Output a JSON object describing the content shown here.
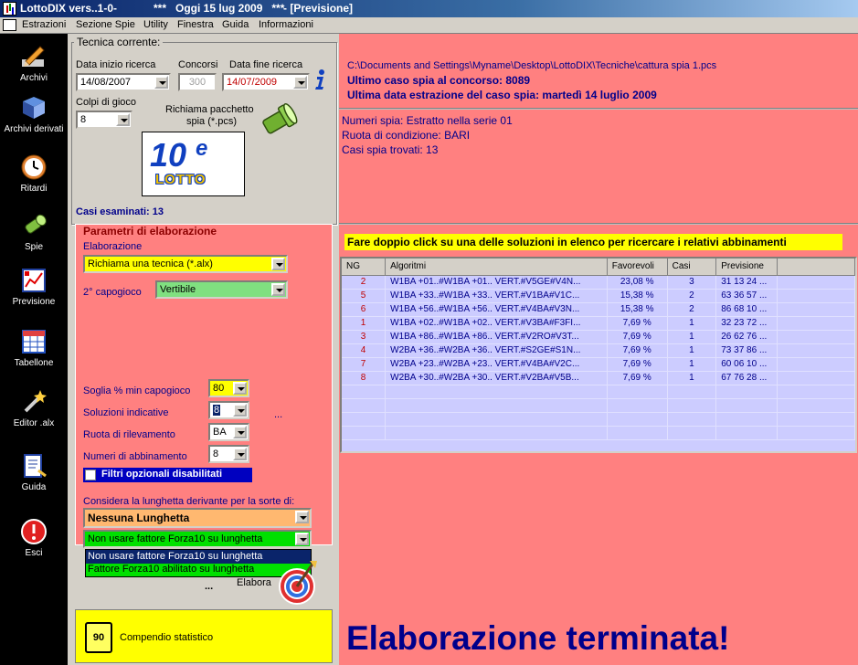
{
  "titlebar": {
    "app_name": "LottoDIX vers..1-0-",
    "date_text": "***   Oggi 15 lug 2009   ***",
    "window_name": "- [Previsione]"
  },
  "menu": [
    "Estrazioni",
    "Sezione Spie",
    "Utility",
    "Finestra",
    "Guida",
    "Informazioni"
  ],
  "sidebar": [
    {
      "label": "Archivi",
      "icon": "pencil-icon"
    },
    {
      "label": "Archivi derivati",
      "icon": "book-icon"
    },
    {
      "label": "Ritardi",
      "icon": "clock-icon"
    },
    {
      "label": "Spie",
      "icon": "flashlight-icon"
    },
    {
      "label": "Previsione",
      "icon": "chart-icon"
    },
    {
      "label": "Tabellone",
      "icon": "grid-icon"
    },
    {
      "label": "Editor .alx",
      "icon": "wand-icon"
    },
    {
      "label": "Guida",
      "icon": "help-book-icon"
    },
    {
      "label": "Esci",
      "icon": "exit-icon"
    }
  ],
  "technique": {
    "legend": "Tecnica corrente:",
    "start_label": "Data inizio ricerca",
    "start_value": "14/08/2007",
    "concorsi_label": "Concorsi",
    "concorsi_value": "300",
    "end_label": "Data fine ricerca",
    "end_value": "14/07/2009",
    "colpi_label": "Colpi di gioco",
    "colpi_value": "8",
    "richiama_label_1": "Richiama pacchetto",
    "richiama_label_2": "spia (*.pcs)",
    "logo_big": "10",
    "logo_e": "e",
    "logo_word": "LOTTO",
    "casi_label": "Casi esaminati: 13"
  },
  "params": {
    "legend": "Parametri di elaborazione",
    "elaborazione_label": "Elaborazione",
    "elaborazione_value": "Richiama una tecnica (*.alx)",
    "capogioco_label": "2° capogioco",
    "capogioco_value": "Vertibile",
    "soglia_label": "Soglia % min capogioco",
    "soglia_value": "80",
    "soluzioni_label": "Soluzioni indicative",
    "soluzioni_value": "8",
    "ellipsis": "...",
    "ruota_label": "Ruota di rilevamento",
    "ruota_value": "BA",
    "numeri_label": "Numeri di abbinamento",
    "numeri_value": "8",
    "filtri_label": "Filtri opzionali disabilitati",
    "lunghetta_label": "Considera la lunghetta derivante per la sorte di:",
    "lunghetta_value": "Nessuna Lunghetta",
    "forza_value": "Non usare fattore Forza10 su lunghetta",
    "dropdown_options": [
      "Non usare fattore Forza10 su lunghetta",
      "Fattore Forza10 abilitato su lunghetta"
    ],
    "elabora_label": "Elabora",
    "elabora_ellipsis": "..."
  },
  "compendio": {
    "badge": "90",
    "label": "Compendio statistico"
  },
  "info": {
    "path": "C:\\Documents and Settings\\Myname\\Desktop\\LottoDIX\\Tecniche\\cattura spia 1.pcs",
    "ultimo": "Ultimo caso spia al concorso:  8089",
    "ultima_data": "Ultima data estrazione del caso spia:  martedì 14 luglio 2009",
    "numeri_spia": "Numeri spia: Estratto nella serie 01",
    "ruota": "Ruota di condizione: BARI",
    "casi_trovati": "Casi spia trovati: 13"
  },
  "banner": "Fare doppio click su una delle soluzioni in elenco per ricercare i relativi abbinamenti",
  "grid": {
    "headers": [
      "NG",
      "Algoritmi",
      "Favorevoli",
      "Casi",
      "Previsione"
    ],
    "rows": [
      [
        "2",
        "W1BA +01..#W1BA +01.. VERT.#V5GE#V4N...",
        "23,08 %",
        "3",
        "31 13 24 ..."
      ],
      [
        "5",
        "W1BA +33..#W1BA +33.. VERT.#V1BA#V1C...",
        "15,38 %",
        "2",
        "63 36 57 ..."
      ],
      [
        "6",
        "W1BA +56..#W1BA +56.. VERT.#V4BA#V3N...",
        "15,38 %",
        "2",
        "86 68 10 ..."
      ],
      [
        "1",
        "W1BA +02..#W1BA +02.. VERT.#V3BA#F3FI...",
        "7,69 %",
        "1",
        "32 23 72 ..."
      ],
      [
        "3",
        "W1BA +86..#W1BA +86.. VERT.#V2RO#V3T...",
        "7,69 %",
        "1",
        "26 62 76 ..."
      ],
      [
        "4",
        "W2BA +36..#W2BA +36.. VERT.#S2GE#S1N...",
        "7,69 %",
        "1",
        "73 37 86 ..."
      ],
      [
        "7",
        "W2BA +23..#W2BA +23.. VERT.#V4BA#V2C...",
        "7,69 %",
        "1",
        "60 06 10 ..."
      ],
      [
        "8",
        "W2BA +30..#W2BA +30.. VERT.#V2BA#V5B...",
        "7,69 %",
        "1",
        "67 76 28 ..."
      ]
    ]
  },
  "status": "Elaborazione terminata!"
}
